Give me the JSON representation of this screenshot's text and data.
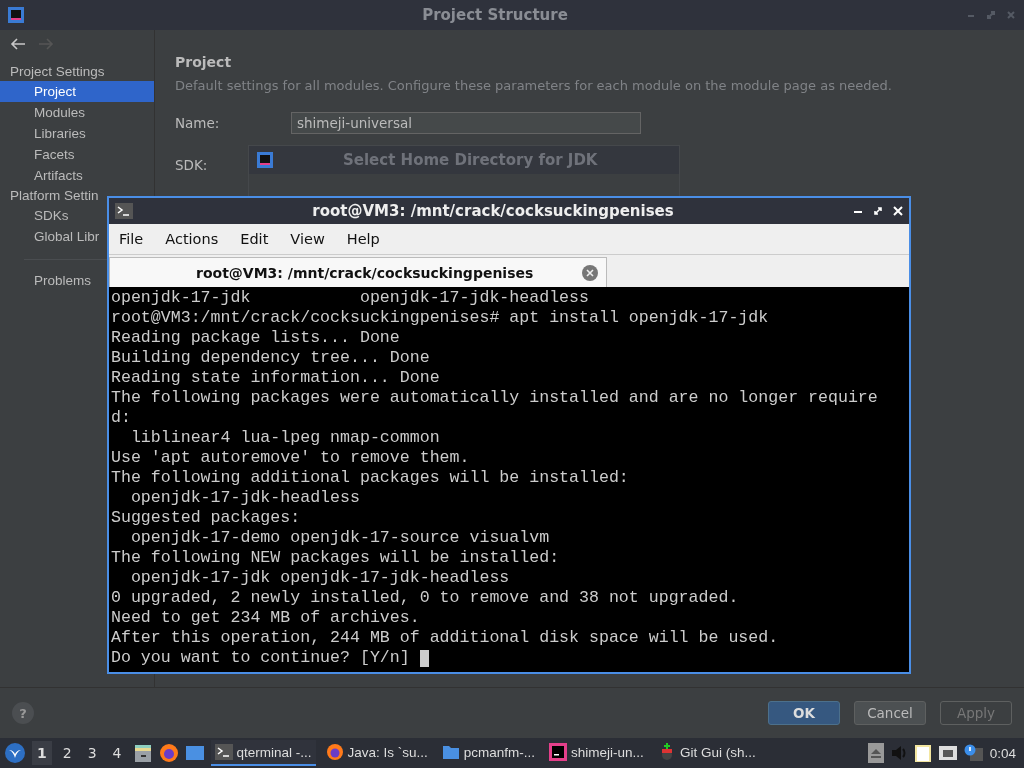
{
  "window": {
    "title": "Project Structure"
  },
  "sidebar": {
    "groups": [
      {
        "label": "Project Settings",
        "items": [
          {
            "label": "Project",
            "selected": true
          },
          {
            "label": "Modules",
            "selected": false
          },
          {
            "label": "Libraries",
            "selected": false
          },
          {
            "label": "Facets",
            "selected": false
          },
          {
            "label": "Artifacts",
            "selected": false
          }
        ]
      },
      {
        "label": "Platform Settin",
        "items": [
          {
            "label": "SDKs",
            "selected": false
          },
          {
            "label": "Global Libr",
            "selected": false
          }
        ]
      }
    ],
    "problems": {
      "label": "Problems",
      "selected": false
    }
  },
  "content": {
    "heading": "Project",
    "description": "Default settings for all modules. Configure these parameters for each module on the module page as needed.",
    "name_label": "Name:",
    "name_value": "shimeji-universal",
    "sdk_label": "SDK:"
  },
  "jdk_dialog": {
    "title": "Select Home Directory for JDK"
  },
  "terminal": {
    "title": "root@VM3: /mnt/crack/cocksuckingpenises",
    "menu": [
      "File",
      "Actions",
      "Edit",
      "View",
      "Help"
    ],
    "tab": {
      "label": "root@VM3: /mnt/crack/cocksuckingpenises",
      "selected": true
    },
    "lines": [
      "openjdk-17-jdk           openjdk-17-jdk-headless",
      "root@VM3:/mnt/crack/cocksuckingpenises# apt install openjdk-17-jdk",
      "Reading package lists... Done",
      "Building dependency tree... Done",
      "Reading state information... Done",
      "The following packages were automatically installed and are no longer require",
      "d:",
      "  liblinear4 lua-lpeg nmap-common",
      "Use 'apt autoremove' to remove them.",
      "The following additional packages will be installed:",
      "  openjdk-17-jdk-headless",
      "Suggested packages:",
      "  openjdk-17-demo openjdk-17-source visualvm",
      "The following NEW packages will be installed:",
      "  openjdk-17-jdk openjdk-17-jdk-headless",
      "0 upgraded, 2 newly installed, 0 to remove and 38 not upgraded.",
      "Need to get 234 MB of archives.",
      "After this operation, 244 MB of additional disk space will be used.",
      "Do you want to continue? [Y/n] "
    ]
  },
  "help_button": "?",
  "buttons": [
    {
      "label": "OK",
      "kind": "primary",
      "disabled": false
    },
    {
      "label": "Cancel",
      "kind": "normal",
      "disabled": false
    },
    {
      "label": "Apply",
      "kind": "normal",
      "disabled": true
    }
  ],
  "taskbar": {
    "workspaces": [
      {
        "label": "1",
        "selected": true
      },
      {
        "label": "2",
        "selected": false
      },
      {
        "label": "3",
        "selected": false
      },
      {
        "label": "4",
        "selected": false
      }
    ],
    "tasks": [
      {
        "label": "qterminal -...",
        "kind": "terminal",
        "selected": true
      },
      {
        "label": "Java: Is `su...",
        "kind": "browser",
        "selected": false
      },
      {
        "label": "pcmanfm-...",
        "kind": "folder",
        "selected": false
      },
      {
        "label": "shimeji-un...",
        "kind": "ide",
        "selected": false
      },
      {
        "label": "Git Gui (sh...",
        "kind": "git",
        "selected": false
      }
    ],
    "clock": "0:04"
  }
}
